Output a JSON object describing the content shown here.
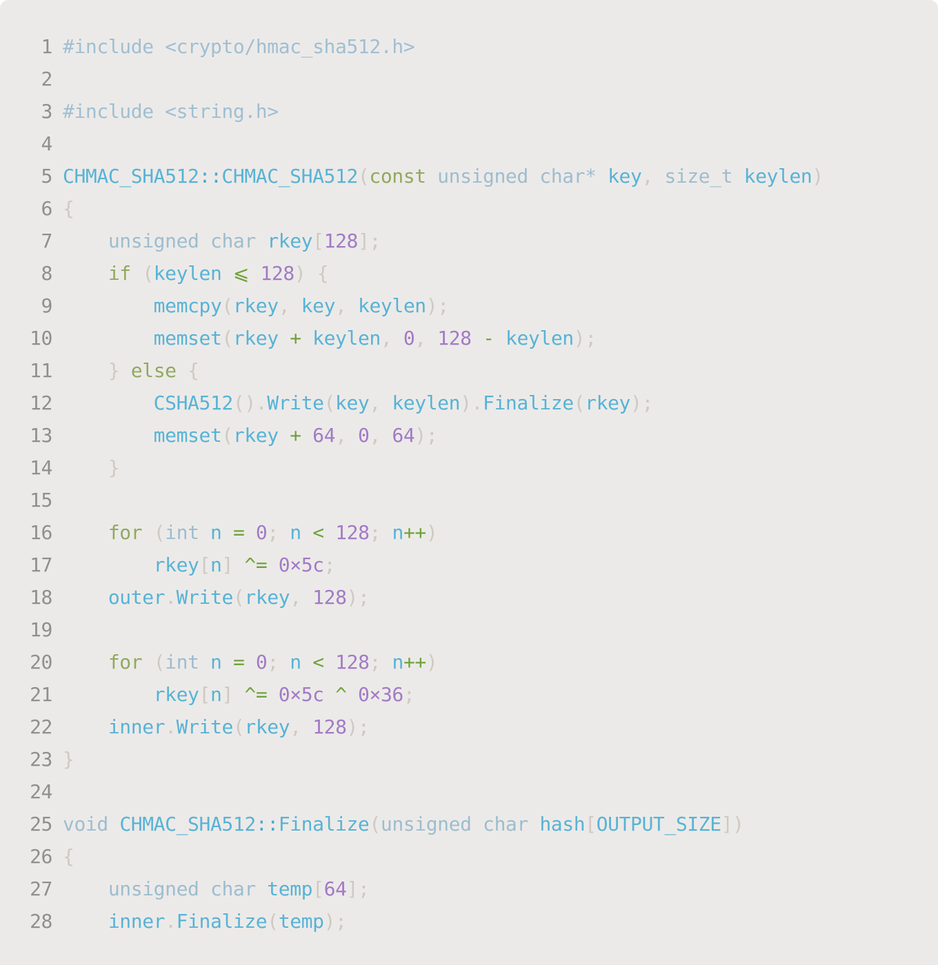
{
  "editor": {
    "lines": [
      {
        "n": "1",
        "tokens": [
          [
            "pp",
            "#include <crypto/hmac_sha512.h>"
          ]
        ]
      },
      {
        "n": "2",
        "tokens": []
      },
      {
        "n": "3",
        "tokens": [
          [
            "pp",
            "#include <string.h>"
          ]
        ]
      },
      {
        "n": "4",
        "tokens": []
      },
      {
        "n": "5",
        "tokens": [
          [
            "id",
            "CHMAC_SHA512"
          ],
          [
            "tx",
            "::"
          ],
          [
            "id",
            "CHMAC_SHA512"
          ],
          [
            "pu",
            "("
          ],
          [
            "kw",
            "const"
          ],
          [
            "tx",
            " "
          ],
          [
            "ty",
            "unsigned"
          ],
          [
            "tx",
            " "
          ],
          [
            "ty",
            "char"
          ],
          [
            "ty",
            "*"
          ],
          [
            "tx",
            " "
          ],
          [
            "id",
            "key"
          ],
          [
            "pu",
            ","
          ],
          [
            "tx",
            " "
          ],
          [
            "ty",
            "size_t"
          ],
          [
            "tx",
            " "
          ],
          [
            "id",
            "keylen"
          ],
          [
            "pu",
            ")"
          ]
        ]
      },
      {
        "n": "6",
        "tokens": [
          [
            "pu",
            "{"
          ]
        ]
      },
      {
        "n": "7",
        "tokens": [
          [
            "tx",
            "    "
          ],
          [
            "ty",
            "unsigned"
          ],
          [
            "tx",
            " "
          ],
          [
            "ty",
            "char"
          ],
          [
            "tx",
            " "
          ],
          [
            "id",
            "rkey"
          ],
          [
            "pu",
            "["
          ],
          [
            "nm",
            "128"
          ],
          [
            "pu",
            "];"
          ]
        ]
      },
      {
        "n": "8",
        "tokens": [
          [
            "tx",
            "    "
          ],
          [
            "kw",
            "if"
          ],
          [
            "tx",
            " "
          ],
          [
            "pu",
            "("
          ],
          [
            "id",
            "keylen"
          ],
          [
            "tx",
            " "
          ],
          [
            "op",
            "⩽"
          ],
          [
            "tx",
            " "
          ],
          [
            "nm",
            "128"
          ],
          [
            "pu",
            ")"
          ],
          [
            "tx",
            " "
          ],
          [
            "pu",
            "{"
          ]
        ]
      },
      {
        "n": "9",
        "tokens": [
          [
            "tx",
            "        "
          ],
          [
            "id",
            "memcpy"
          ],
          [
            "pu",
            "("
          ],
          [
            "id",
            "rkey"
          ],
          [
            "pu",
            ","
          ],
          [
            "tx",
            " "
          ],
          [
            "id",
            "key"
          ],
          [
            "pu",
            ","
          ],
          [
            "tx",
            " "
          ],
          [
            "id",
            "keylen"
          ],
          [
            "pu",
            ");"
          ]
        ]
      },
      {
        "n": "10",
        "tokens": [
          [
            "tx",
            "        "
          ],
          [
            "id",
            "memset"
          ],
          [
            "pu",
            "("
          ],
          [
            "id",
            "rkey"
          ],
          [
            "tx",
            " "
          ],
          [
            "op",
            "+"
          ],
          [
            "tx",
            " "
          ],
          [
            "id",
            "keylen"
          ],
          [
            "pu",
            ","
          ],
          [
            "tx",
            " "
          ],
          [
            "nm",
            "0"
          ],
          [
            "pu",
            ","
          ],
          [
            "tx",
            " "
          ],
          [
            "nm",
            "128"
          ],
          [
            "tx",
            " "
          ],
          [
            "op",
            "-"
          ],
          [
            "tx",
            " "
          ],
          [
            "id",
            "keylen"
          ],
          [
            "pu",
            ");"
          ]
        ]
      },
      {
        "n": "11",
        "tokens": [
          [
            "tx",
            "    "
          ],
          [
            "pu",
            "}"
          ],
          [
            "tx",
            " "
          ],
          [
            "kw",
            "else"
          ],
          [
            "tx",
            " "
          ],
          [
            "pu",
            "{"
          ]
        ]
      },
      {
        "n": "12",
        "tokens": [
          [
            "tx",
            "        "
          ],
          [
            "id",
            "CSHA512"
          ],
          [
            "pu",
            "()."
          ],
          [
            "id",
            "Write"
          ],
          [
            "pu",
            "("
          ],
          [
            "id",
            "key"
          ],
          [
            "pu",
            ","
          ],
          [
            "tx",
            " "
          ],
          [
            "id",
            "keylen"
          ],
          [
            "pu",
            ")."
          ],
          [
            "id",
            "Finalize"
          ],
          [
            "pu",
            "("
          ],
          [
            "id",
            "rkey"
          ],
          [
            "pu",
            ");"
          ]
        ]
      },
      {
        "n": "13",
        "tokens": [
          [
            "tx",
            "        "
          ],
          [
            "id",
            "memset"
          ],
          [
            "pu",
            "("
          ],
          [
            "id",
            "rkey"
          ],
          [
            "tx",
            " "
          ],
          [
            "op",
            "+"
          ],
          [
            "tx",
            " "
          ],
          [
            "nm",
            "64"
          ],
          [
            "pu",
            ","
          ],
          [
            "tx",
            " "
          ],
          [
            "nm",
            "0"
          ],
          [
            "pu",
            ","
          ],
          [
            "tx",
            " "
          ],
          [
            "nm",
            "64"
          ],
          [
            "pu",
            ");"
          ]
        ]
      },
      {
        "n": "14",
        "tokens": [
          [
            "tx",
            "    "
          ],
          [
            "pu",
            "}"
          ]
        ]
      },
      {
        "n": "15",
        "tokens": []
      },
      {
        "n": "16",
        "tokens": [
          [
            "tx",
            "    "
          ],
          [
            "kw",
            "for"
          ],
          [
            "tx",
            " "
          ],
          [
            "pu",
            "("
          ],
          [
            "ty",
            "int"
          ],
          [
            "tx",
            " "
          ],
          [
            "id",
            "n"
          ],
          [
            "tx",
            " "
          ],
          [
            "op",
            "="
          ],
          [
            "tx",
            " "
          ],
          [
            "nm",
            "0"
          ],
          [
            "pu",
            ";"
          ],
          [
            "tx",
            " "
          ],
          [
            "id",
            "n"
          ],
          [
            "tx",
            " "
          ],
          [
            "op",
            "<"
          ],
          [
            "tx",
            " "
          ],
          [
            "nm",
            "128"
          ],
          [
            "pu",
            ";"
          ],
          [
            "tx",
            " "
          ],
          [
            "id",
            "n"
          ],
          [
            "op",
            "++"
          ],
          [
            "pu",
            ")"
          ]
        ]
      },
      {
        "n": "17",
        "tokens": [
          [
            "tx",
            "        "
          ],
          [
            "id",
            "rkey"
          ],
          [
            "pu",
            "["
          ],
          [
            "id",
            "n"
          ],
          [
            "pu",
            "]"
          ],
          [
            "tx",
            " "
          ],
          [
            "op",
            "^="
          ],
          [
            "tx",
            " "
          ],
          [
            "nm",
            "0×5c"
          ],
          [
            "pu",
            ";"
          ]
        ]
      },
      {
        "n": "18",
        "tokens": [
          [
            "tx",
            "    "
          ],
          [
            "id",
            "outer"
          ],
          [
            "pu",
            "."
          ],
          [
            "id",
            "Write"
          ],
          [
            "pu",
            "("
          ],
          [
            "id",
            "rkey"
          ],
          [
            "pu",
            ","
          ],
          [
            "tx",
            " "
          ],
          [
            "nm",
            "128"
          ],
          [
            "pu",
            ");"
          ]
        ]
      },
      {
        "n": "19",
        "tokens": []
      },
      {
        "n": "20",
        "tokens": [
          [
            "tx",
            "    "
          ],
          [
            "kw",
            "for"
          ],
          [
            "tx",
            " "
          ],
          [
            "pu",
            "("
          ],
          [
            "ty",
            "int"
          ],
          [
            "tx",
            " "
          ],
          [
            "id",
            "n"
          ],
          [
            "tx",
            " "
          ],
          [
            "op",
            "="
          ],
          [
            "tx",
            " "
          ],
          [
            "nm",
            "0"
          ],
          [
            "pu",
            ";"
          ],
          [
            "tx",
            " "
          ],
          [
            "id",
            "n"
          ],
          [
            "tx",
            " "
          ],
          [
            "op",
            "<"
          ],
          [
            "tx",
            " "
          ],
          [
            "nm",
            "128"
          ],
          [
            "pu",
            ";"
          ],
          [
            "tx",
            " "
          ],
          [
            "id",
            "n"
          ],
          [
            "op",
            "++"
          ],
          [
            "pu",
            ")"
          ]
        ]
      },
      {
        "n": "21",
        "tokens": [
          [
            "tx",
            "        "
          ],
          [
            "id",
            "rkey"
          ],
          [
            "pu",
            "["
          ],
          [
            "id",
            "n"
          ],
          [
            "pu",
            "]"
          ],
          [
            "tx",
            " "
          ],
          [
            "op",
            "^="
          ],
          [
            "tx",
            " "
          ],
          [
            "nm",
            "0×5c"
          ],
          [
            "tx",
            " "
          ],
          [
            "op",
            "^"
          ],
          [
            "tx",
            " "
          ],
          [
            "nm",
            "0×36"
          ],
          [
            "pu",
            ";"
          ]
        ]
      },
      {
        "n": "22",
        "tokens": [
          [
            "tx",
            "    "
          ],
          [
            "id",
            "inner"
          ],
          [
            "pu",
            "."
          ],
          [
            "id",
            "Write"
          ],
          [
            "pu",
            "("
          ],
          [
            "id",
            "rkey"
          ],
          [
            "pu",
            ","
          ],
          [
            "tx",
            " "
          ],
          [
            "nm",
            "128"
          ],
          [
            "pu",
            ");"
          ]
        ]
      },
      {
        "n": "23",
        "tokens": [
          [
            "pu",
            "}"
          ]
        ]
      },
      {
        "n": "24",
        "tokens": []
      },
      {
        "n": "25",
        "tokens": [
          [
            "ty",
            "void"
          ],
          [
            "tx",
            " "
          ],
          [
            "id",
            "CHMAC_SHA512"
          ],
          [
            "tx",
            "::"
          ],
          [
            "id",
            "Finalize"
          ],
          [
            "pu",
            "("
          ],
          [
            "ty",
            "unsigned"
          ],
          [
            "tx",
            " "
          ],
          [
            "ty",
            "char"
          ],
          [
            "tx",
            " "
          ],
          [
            "id",
            "hash"
          ],
          [
            "pu",
            "["
          ],
          [
            "id",
            "OUTPUT_SIZE"
          ],
          [
            "pu",
            "])"
          ]
        ]
      },
      {
        "n": "26",
        "tokens": [
          [
            "pu",
            "{"
          ]
        ]
      },
      {
        "n": "27",
        "tokens": [
          [
            "tx",
            "    "
          ],
          [
            "ty",
            "unsigned"
          ],
          [
            "tx",
            " "
          ],
          [
            "ty",
            "char"
          ],
          [
            "tx",
            " "
          ],
          [
            "id",
            "temp"
          ],
          [
            "pu",
            "["
          ],
          [
            "nm",
            "64"
          ],
          [
            "pu",
            "];"
          ]
        ]
      },
      {
        "n": "28",
        "tokens": [
          [
            "tx",
            "    "
          ],
          [
            "id",
            "inner"
          ],
          [
            "pu",
            "."
          ],
          [
            "id",
            "Finalize"
          ],
          [
            "pu",
            "("
          ],
          [
            "id",
            "temp"
          ],
          [
            "pu",
            ");"
          ]
        ]
      }
    ]
  }
}
